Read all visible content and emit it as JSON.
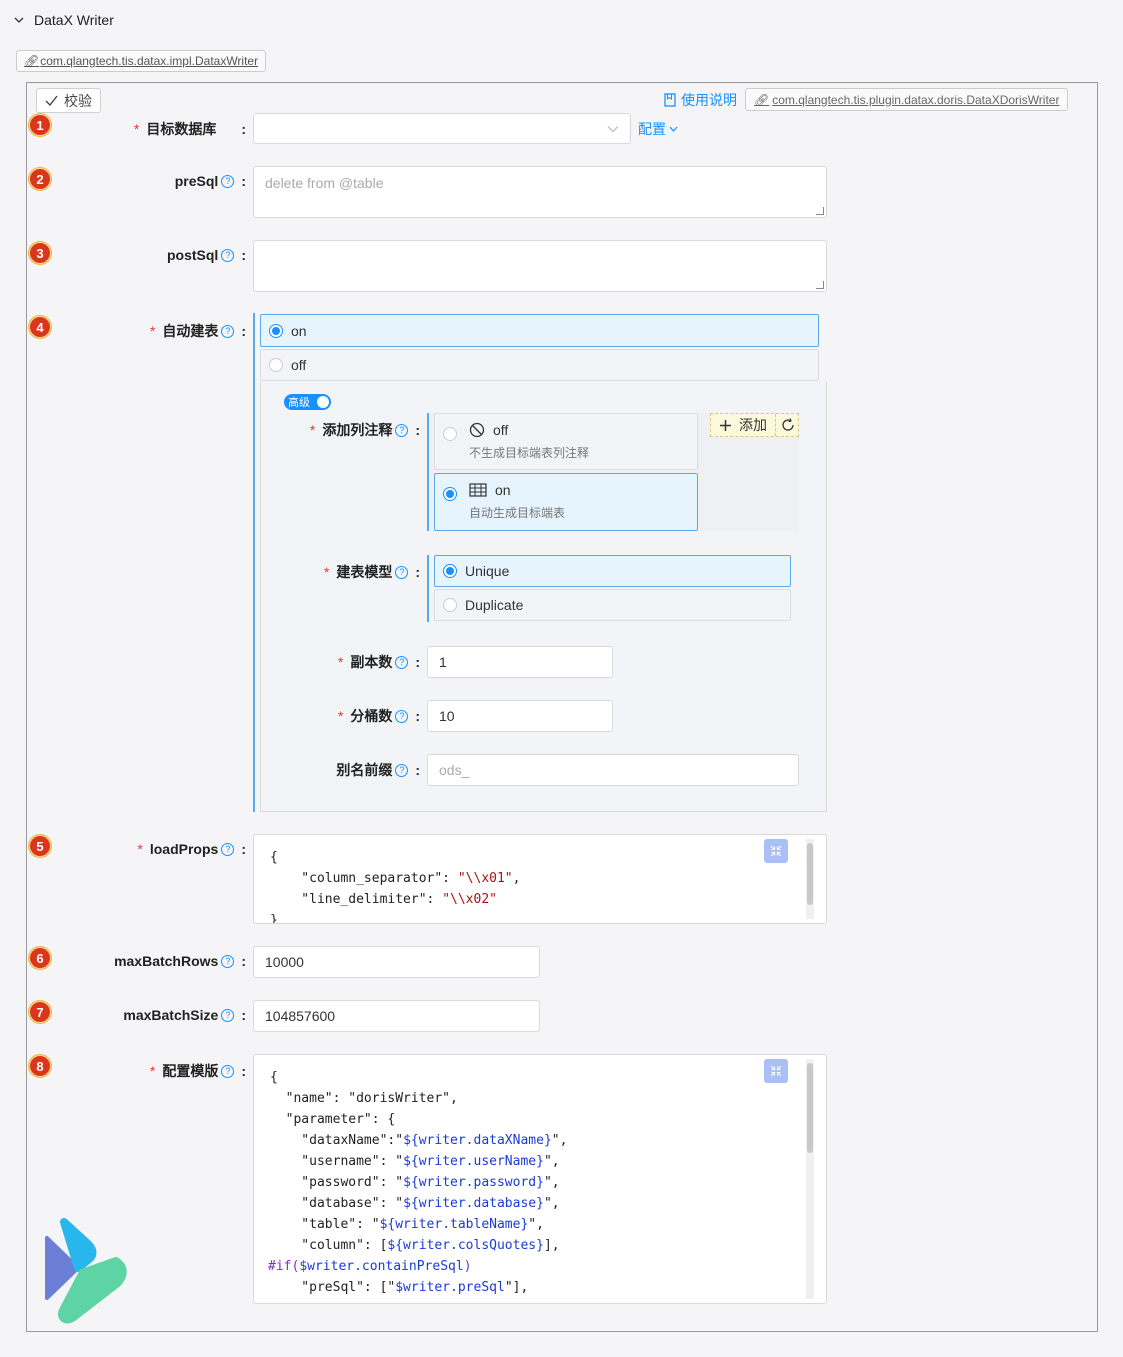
{
  "header": {
    "title": "DataX Writer"
  },
  "impl_class": "com.qlangtech.tis.datax.impl.DataxWriter",
  "toolbar": {
    "verify_label": "校验",
    "manual_label": "使用说明",
    "plugin_class": "com.qlangtech.tis.plugin.datax.doris.DataXDorisWriter"
  },
  "fields": {
    "target_db": {
      "num": "1",
      "label": "目标数据库",
      "value": "",
      "config_label": "配置"
    },
    "preSql": {
      "num": "2",
      "label": "preSql",
      "placeholder": "delete from @table"
    },
    "postSql": {
      "num": "3",
      "label": "postSql",
      "placeholder": ""
    },
    "auto_create": {
      "num": "4",
      "label": "自动建表",
      "options": [
        "on",
        "off"
      ],
      "selected": "on",
      "advanced_label": "高级",
      "add_comment": {
        "label": "添加列注释",
        "options": [
          {
            "title": "off",
            "desc": "不生成目标端表列注释",
            "icon": "ban-icon"
          },
          {
            "title": "on",
            "desc": "自动生成目标端表",
            "icon": "table-icon"
          }
        ],
        "selected": "on",
        "add_label": "添加"
      },
      "model": {
        "label": "建表模型",
        "options": [
          "Unique",
          "Duplicate"
        ],
        "selected": "Unique"
      },
      "replicas": {
        "label": "副本数",
        "value": "1"
      },
      "buckets": {
        "label": "分桶数",
        "value": "10"
      },
      "alias_prefix": {
        "label": "别名前缀",
        "placeholder": "ods_"
      }
    },
    "loadProps": {
      "num": "5",
      "label": "loadProps",
      "lines": [
        "{",
        "    \"column_separator\": \"\\\\x01\",",
        "    \"line_delimiter\": \"\\\\x02\"",
        "}"
      ]
    },
    "maxBatchRows": {
      "num": "6",
      "label": "maxBatchRows",
      "value": "10000"
    },
    "maxBatchSize": {
      "num": "7",
      "label": "maxBatchSize",
      "value": "104857600"
    },
    "template": {
      "num": "8",
      "label": "配置模版",
      "lines": [
        "{",
        "  \"name\": \"dorisWriter\",",
        "  \"parameter\": {",
        "    \"dataxName\":\"${writer.dataXName}\",",
        "    \"username\": \"${writer.userName}\",",
        "    \"password\": \"${writer.password}\",",
        "    \"database\": \"${writer.database}\",",
        "    \"table\": \"${writer.tableName}\",",
        "    \"column\": [${writer.colsQuotes}],",
        "#if($writer.containPreSql)",
        "    \"preSql\": [\"$writer.preSql\"],"
      ]
    }
  },
  "colors": {
    "accent": "#1890ff",
    "required": "#e53935",
    "badge": "#d9361b"
  }
}
